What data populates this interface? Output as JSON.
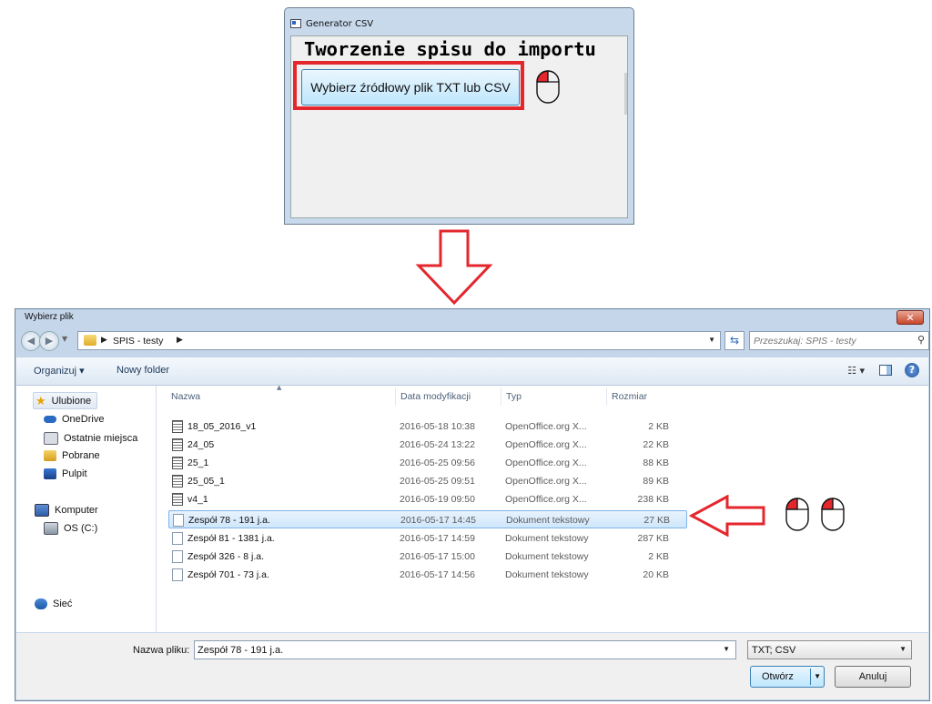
{
  "generator": {
    "window_title": "Generator CSV",
    "heading": "Tworzenie spisu do importu",
    "choose_button": "Wybierz źródłowy plik TXT lub CSV"
  },
  "colors": {
    "highlight": "#e4262d",
    "mouse_button": "#e4262d"
  },
  "icons": [
    "app-icon",
    "mouse-left-click-icon",
    "down-arrow-icon",
    "left-arrow-icon",
    "mouse-double-click-icon",
    "folder-icon",
    "star-icon",
    "computer-icon",
    "network-icon",
    "text-file-icon",
    "spreadsheet-file-icon"
  ],
  "dialog": {
    "title": "Wybierz plik",
    "close_label": "✕",
    "breadcrumb": "SPIS - testy",
    "search_placeholder": "Przeszukaj: SPIS - testy",
    "toolbar": {
      "organize": "Organizuj ▾",
      "new_folder": "Nowy folder"
    },
    "sidebar": {
      "favorites": "Ulubione",
      "items": [
        "OneDrive",
        "Ostatnie miejsca",
        "Pobrane",
        "Pulpit"
      ],
      "computer": "Komputer",
      "drives": [
        "OS (C:)"
      ],
      "network": "Sieć"
    },
    "columns": {
      "name": "Nazwa",
      "date": "Data modyfikacji",
      "type": "Typ",
      "size": "Rozmiar"
    },
    "files": [
      {
        "name": "18_05_2016_v1",
        "date": "2016-05-18 10:38",
        "type": "OpenOffice.org X...",
        "size": "2 KB",
        "icon": "sheet"
      },
      {
        "name": "24_05",
        "date": "2016-05-24 13:22",
        "type": "OpenOffice.org X...",
        "size": "22 KB",
        "icon": "sheet"
      },
      {
        "name": "25_1",
        "date": "2016-05-25 09:56",
        "type": "OpenOffice.org X...",
        "size": "88 KB",
        "icon": "sheet"
      },
      {
        "name": "25_05_1",
        "date": "2016-05-25 09:51",
        "type": "OpenOffice.org X...",
        "size": "89 KB",
        "icon": "sheet"
      },
      {
        "name": "v4_1",
        "date": "2016-05-19 09:50",
        "type": "OpenOffice.org X...",
        "size": "238 KB",
        "icon": "sheet"
      },
      {
        "name": "Zespół 78 - 191 j.a.",
        "date": "2016-05-17 14:45",
        "type": "Dokument tekstowy",
        "size": "27 KB",
        "icon": "text",
        "selected": true
      },
      {
        "name": "Zespół 81 - 1381 j.a.",
        "date": "2016-05-17 14:59",
        "type": "Dokument tekstowy",
        "size": "287 KB",
        "icon": "text"
      },
      {
        "name": "Zespół 326 - 8 j.a.",
        "date": "2016-05-17 15:00",
        "type": "Dokument tekstowy",
        "size": "2 KB",
        "icon": "text"
      },
      {
        "name": "Zespół 701 - 73 j.a.",
        "date": "2016-05-17 14:56",
        "type": "Dokument tekstowy",
        "size": "20 KB",
        "icon": "text"
      }
    ],
    "filename_label": "Nazwa pliku:",
    "filename_value": "Zespół 78 - 191 j.a.",
    "filetype": "TXT; CSV",
    "open_button": "Otwórz",
    "cancel_button": "Anuluj"
  }
}
